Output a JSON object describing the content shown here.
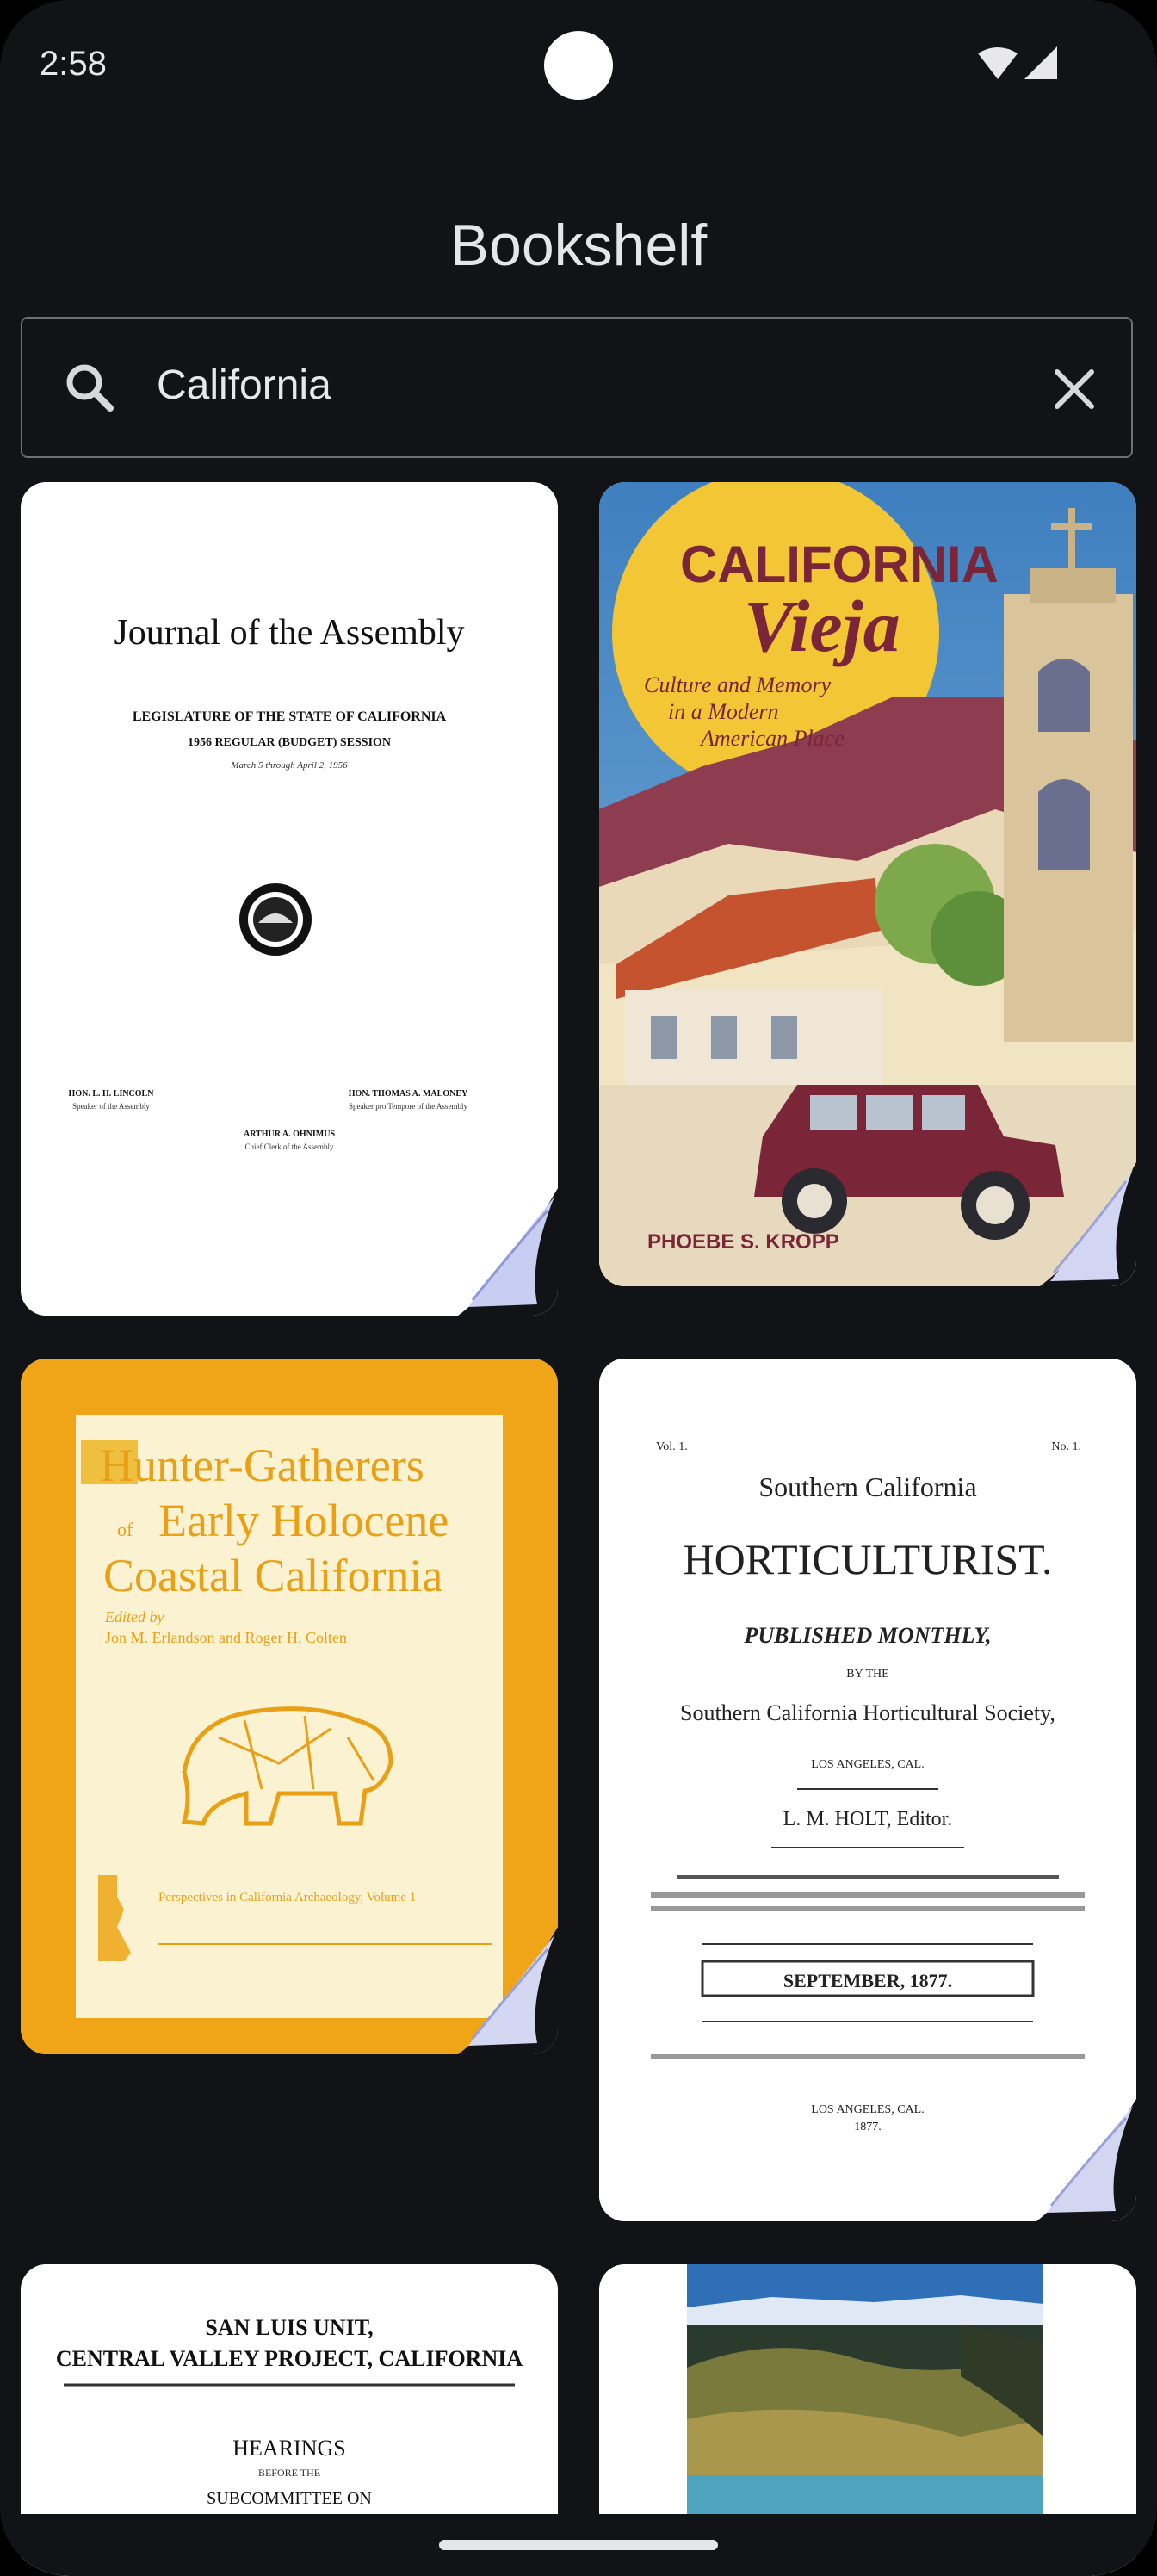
{
  "status_bar": {
    "time": "2:58",
    "icons": [
      "wifi-icon",
      "signal-icon"
    ]
  },
  "app": {
    "title": "Bookshelf"
  },
  "search": {
    "value": "California",
    "icon": "search-icon",
    "clear_icon": "close-icon"
  },
  "books": [
    {
      "cover_lines": [
        "Journal of the Assembly",
        "LEGISLATURE OF THE STATE OF CALIFORNIA",
        "1956 REGULAR (BUDGET) SESSION",
        "March 5 through April 2, 1956",
        "HON. L. H. LINCOLN",
        "Speaker of the Assembly",
        "HON. THOMAS A. MALONEY",
        "Speaker pro Tempore of the Assembly",
        "ARTHUR A. OHNIMUS",
        "Chief Clerk of the Assembly"
      ]
    },
    {
      "cover_lines": [
        "CALIFORNIA",
        "Vieja",
        "Culture and Memory",
        "in a Modern",
        "American Place",
        "PHOEBE S. KROPP"
      ]
    },
    {
      "cover_lines": [
        "Hunter-Gatherers",
        "of",
        "Early Holocene",
        "Coastal California",
        "Edited by",
        "Jon M. Erlandson and Roger H. Colten",
        "Perspectives in California Archaeology, Volume 1"
      ]
    },
    {
      "cover_lines": [
        "Vol. 1.",
        "No. 1.",
        "Southern California",
        "HORTICULTURIST.",
        "PUBLISHED MONTHLY,",
        "BY THE",
        "Southern California Horticultural Society,",
        "LOS ANGELES, CAL.",
        "L. M. HOLT, Editor.",
        "SEPTEMBER, 1877.",
        "LOS ANGELES, CAL.",
        "1877."
      ]
    },
    {
      "cover_lines": [
        "SAN LUIS UNIT,",
        "CENTRAL VALLEY PROJECT, CALIFORNIA",
        "HEARINGS",
        "BEFORE THE",
        "SUBCOMMITTEE ON"
      ]
    },
    {
      "cover_lines": []
    }
  ],
  "colors": {
    "background": "#121317",
    "text": "#e6e6e8",
    "search_border": "#6f7075",
    "vieja_sun": "#f2c634",
    "hunter_orange": "#f0a418",
    "hunter_text": "#e8a017"
  }
}
